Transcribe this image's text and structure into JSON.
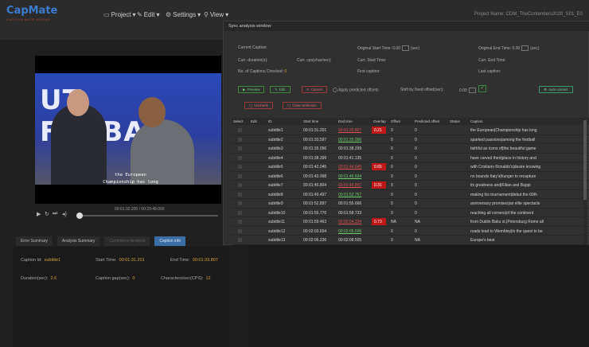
{
  "app": {
    "logo": "CapMate",
    "logo_sub": "CAPTION MATE WORKS",
    "project_name": "Project Name: CDM_TheContenders2020_S01_E0"
  },
  "menu": [
    {
      "label": "Project",
      "icon": "folder-icon",
      "glyph": "▭"
    },
    {
      "label": "Edit",
      "icon": "edit-icon",
      "glyph": "✎"
    },
    {
      "label": "Settings",
      "icon": "gear-icon",
      "glyph": "⚙"
    },
    {
      "label": "View",
      "icon": "search-icon",
      "glyph": "⚲"
    }
  ],
  "video": {
    "overlay_text": "UT FOTBALL",
    "caption_line1": "the European",
    "caption_line2": "Championship has long"
  },
  "player": {
    "timecode": "00:01:32.200 / 00:29:48.000"
  },
  "tabs": [
    {
      "label": "Error Summary",
      "state": "normal"
    },
    {
      "label": "Analysis Summary",
      "state": "normal"
    },
    {
      "label": "Confidence Analysis",
      "state": "dim"
    },
    {
      "label": "Caption info",
      "state": "active"
    }
  ],
  "caption_info": {
    "caption_id_label": "Caption Id:",
    "caption_id": "subtitle1",
    "start_label": "Start Time:",
    "start": "00:01:31.201",
    "end_label": "End Time:",
    "end": "00:01:33.807",
    "duration_label": "Duration(sec):",
    "duration": "2.6",
    "gap_label": "Caption gap(sec):",
    "gap": "0",
    "cps_label": "Characters/sec(CPS):",
    "cps": "12"
  },
  "dialog": {
    "title": "Sync analysis window",
    "current_caption": "Current Caption:",
    "curr_duration": "Curr. duration(s):",
    "curr_cps": "Curr. cps(char/sec):",
    "captions_checked_label": "No. of Captions Checked:",
    "captions_checked": "0",
    "orig_start_label": "Original Start Time:",
    "orig_start": "0.00",
    "sec": "(sec)",
    "curr_start": "Curr. Start Time:",
    "first_caption": "First caption:",
    "orig_end_label": "Original End Time:",
    "orig_end": "0.00",
    "curr_end": "Curr. End Time:",
    "last_caption": "Last caption:",
    "preview": "Preview",
    "edit": "Edit",
    "cancel": "Cancel",
    "apply_predicted": "Apply predicted offsets",
    "shift_label": "Shift by fixed offset(sec):",
    "shift_val": "0.00",
    "autocorrect": "Auto-correct",
    "uncheck": "Uncheck",
    "clear_selection": "Clear Selection"
  },
  "table": {
    "headers": [
      "Select",
      "Edit",
      "ID",
      "Start time",
      "End time",
      "Overlap",
      "Offset",
      "Predicted offset",
      "Status",
      "Caption"
    ],
    "rows": [
      {
        "id": "subtitle1",
        "start": "00:01:31.201",
        "end": "00:01:33.807",
        "end_style": "red",
        "overlap": "0.21",
        "offset": "0",
        "predicted": "0",
        "caption": "the European|Championship has long"
      },
      {
        "id": "subtitle2",
        "start": "00:01:33.597",
        "end": "00:01:35.096",
        "end_style": "green",
        "overlap": "",
        "offset": "0",
        "predicted": "0",
        "caption": "sparked passions|among the football"
      },
      {
        "id": "subtitle3",
        "start": "00:01:35.096",
        "end": "00:01:38.299",
        "end_style": "plain",
        "overlap": "",
        "offset": "0",
        "predicted": "0",
        "caption": "faithful as icons of|the beautiful game"
      },
      {
        "id": "subtitle4",
        "start": "00:01:38.399",
        "end": "00:01:41.135",
        "end_style": "plain",
        "overlap": "",
        "offset": "0",
        "predicted": "0",
        "caption": "have carved their|place in history and"
      },
      {
        "id": "subtitle5",
        "start": "00:01:42.045",
        "end": "00:01:44.645",
        "end_style": "red",
        "overlap": "0.65",
        "offset": "0",
        "predicted": "0",
        "caption": "with Cristiano Ronaldo's|desire knowing"
      },
      {
        "id": "subtitle6",
        "start": "00:01:43.998",
        "end": "00:01:46.634",
        "end_style": "green",
        "overlap": "",
        "offset": "0",
        "predicted": "0",
        "caption": "no bounds Italy's|hunger to recapture"
      },
      {
        "id": "subtitle7",
        "start": "00:01:46.804",
        "end": "00:01:49.807",
        "end_style": "red",
        "overlap": "0.31",
        "offset": "0",
        "predicted": "0",
        "caption": "its greatness and|Kilian and Bappi"
      },
      {
        "id": "subtitle8",
        "start": "00:01:49.497",
        "end": "00:01:52.767",
        "end_style": "green",
        "overlap": "",
        "offset": "0",
        "predicted": "0",
        "caption": "making his tournament|debut the 60th"
      },
      {
        "id": "subtitle9",
        "start": "00:01:52.897",
        "end": "00:01:55.666",
        "end_style": "plain",
        "overlap": "",
        "offset": "0",
        "predicted": "0",
        "caption": "anniversary promises|an elite spectacle"
      },
      {
        "id": "subtitle10",
        "start": "00:01:55.776",
        "end": "00:01:58.733",
        "end_style": "plain",
        "overlap": "",
        "offset": "0",
        "predicted": "0",
        "caption": "reaching all corners|of the continent"
      },
      {
        "id": "subtitle11",
        "start": "00:01:59.463",
        "end": "00:02:04.334",
        "end_style": "red",
        "overlap": "0.73",
        "offset": "NA",
        "predicted": "NA",
        "caption": "from Dublin Baku st.|Petersburg Rome all"
      },
      {
        "id": "subtitle12",
        "start": "00:02:03.604",
        "end": "00:02:05.506",
        "end_style": "green",
        "overlap": "",
        "offset": "0",
        "predicted": "0",
        "caption": "roads lead to Wembley|in the quest to be"
      },
      {
        "id": "subtitle13",
        "start": "00:02:06.236",
        "end": "00:02:08.505",
        "end_style": "plain",
        "overlap": "",
        "offset": "0",
        "predicted": "NA",
        "caption": "Europe's best"
      }
    ]
  }
}
